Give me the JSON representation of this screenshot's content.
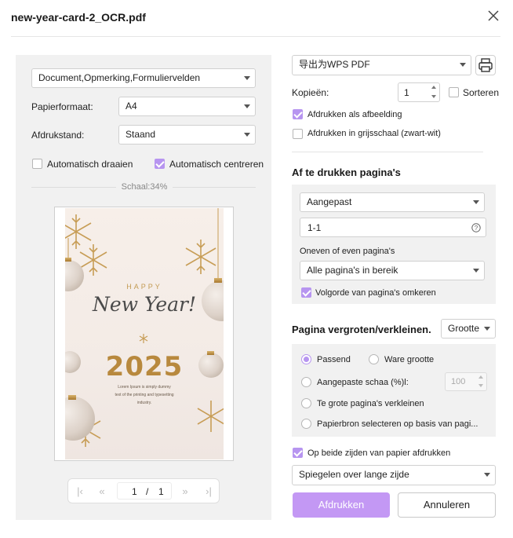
{
  "window": {
    "title": "new-year-card-2_OCR.pdf"
  },
  "left": {
    "content_select": "Document,Opmerking,Formuliervelden",
    "paper_size_label": "Papierformaat:",
    "paper_size_value": "A4",
    "orientation_label": "Afdrukstand:",
    "orientation_value": "Staand",
    "auto_rotate_label": "Automatisch draaien",
    "auto_rotate_checked": false,
    "auto_center_label": "Automatisch centreren",
    "auto_center_checked": true,
    "scale_text": "Schaal:34%"
  },
  "preview": {
    "happy": "HAPPY",
    "new_year": "New Year!",
    "year": "2025",
    "line1": "Lorem Ipsum is simply dummy",
    "line2": "text of the printing and typesetting",
    "line3": "industry."
  },
  "pager": {
    "current": "1",
    "separator": "/",
    "total": "1"
  },
  "right": {
    "printer": "导出为WPS PDF",
    "copies_label": "Kopieën:",
    "copies_value": "1",
    "sort_label": "Sorteren",
    "sort_checked": false,
    "print_as_image_label": "Afdrukken als afbeelding",
    "print_as_image_checked": true,
    "grayscale_label": "Afdrukken in grijsschaal (zwart-wit)",
    "grayscale_checked": false,
    "pages_heading": "Af te drukken pagina's",
    "range_mode": "Aangepast",
    "range_value": "1-1",
    "odd_even_label": "Oneven of even pagina's",
    "odd_even_value": "Alle pagina's in bereik",
    "reverse_label": "Volgorde van pagina's omkeren",
    "reverse_checked": true,
    "scale_heading": "Pagina vergroten/verkleinen.",
    "scale_mode": "Grootte",
    "fit_label": "Passend",
    "actual_size_label": "Ware grootte",
    "custom_scale_label": "Aangepaste schaa (%)l:",
    "custom_scale_value": "100",
    "shrink_label": "Te grote pagina's verkleinen",
    "paper_source_label": "Papierbron selecteren op basis van pagi...",
    "selected_scale_option": "fit",
    "duplex_label": "Op beide zijden van papier afdrukken",
    "duplex_checked": true,
    "duplex_mode": "Spiegelen over lange zijde",
    "print_button": "Afdrukken",
    "cancel_button": "Annuleren"
  },
  "colors": {
    "accent": "#c398f4",
    "check": "#b795f0",
    "gold": "#c29a52"
  },
  "icons": [
    "close-icon",
    "printer-icon",
    "help-icon",
    "first-page-icon",
    "prev-page-icon",
    "next-page-icon",
    "last-page-icon",
    "chevron-down-icon"
  ]
}
